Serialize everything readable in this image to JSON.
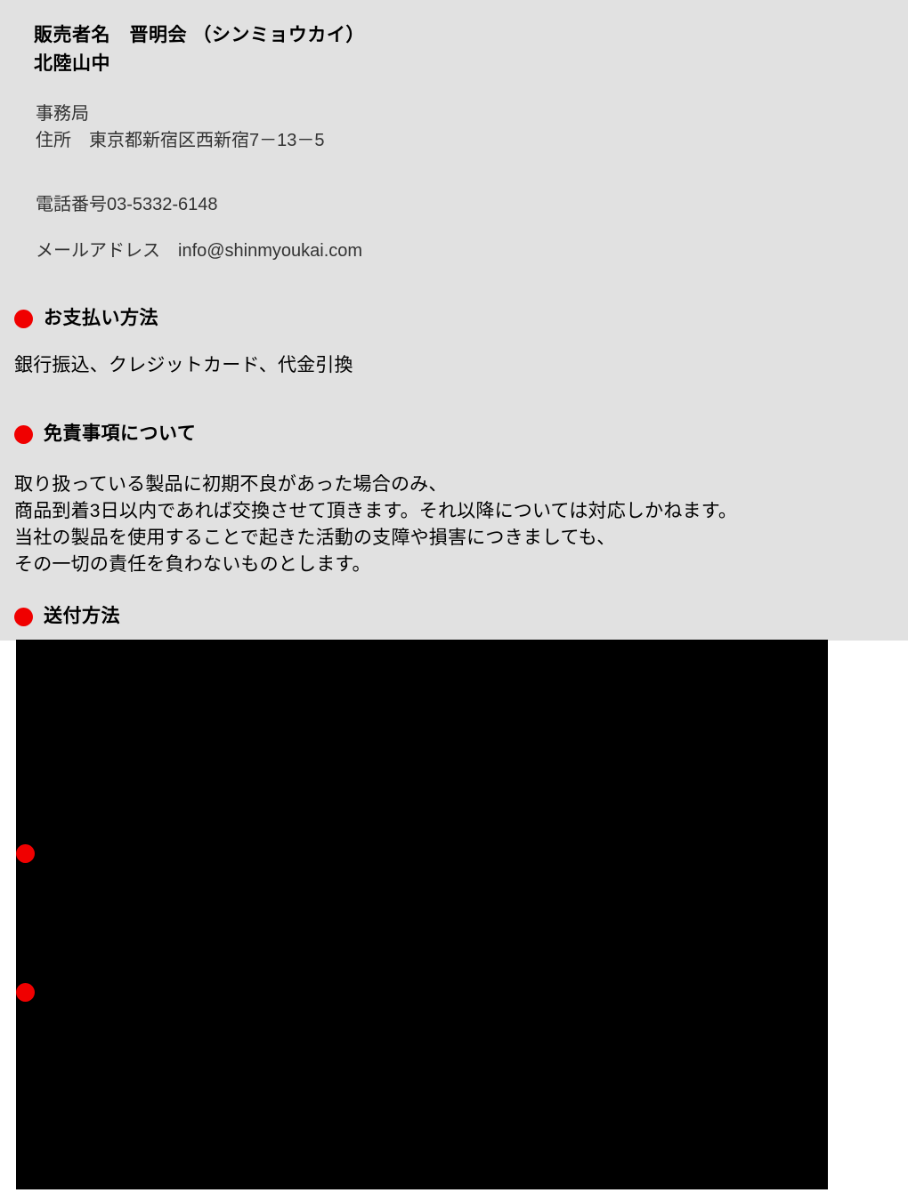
{
  "page": {
    "background_color": "#ffffff",
    "panel_color": "#e1e1e1",
    "accent_color": "#f00000",
    "text_color": "#000000",
    "muted_text_color": "#333333"
  },
  "seller": {
    "name_line": "販売者名　晋明会 （シンミョウカイ）",
    "branch_line": "北陸山中"
  },
  "office": {
    "label": "事務局",
    "address": "住所　東京都新宿区西新宿7－13－5",
    "tel": "電話番号03-5332-6148",
    "email": "メールアドレス　info@shinmyoukai.com"
  },
  "sections": {
    "payment": {
      "heading": "お支払い方法",
      "body": "銀行振込、クレジットカード、代金引換"
    },
    "disclaimer": {
      "heading": "免責事項について",
      "body": "取り扱っている製品に初期不良があった場合のみ、\n商品到着3日以内であれば交換させて頂きます。それ以降については対応しかねます。\n当社の製品を使用することで起きた活動の支障や損害につきましても、\nその一切の責任を負わないものとします。"
    },
    "shipping": {
      "heading": "送付方法"
    }
  },
  "media": {
    "placeholder_color": "#000000",
    "marker_color": "#f00000"
  }
}
